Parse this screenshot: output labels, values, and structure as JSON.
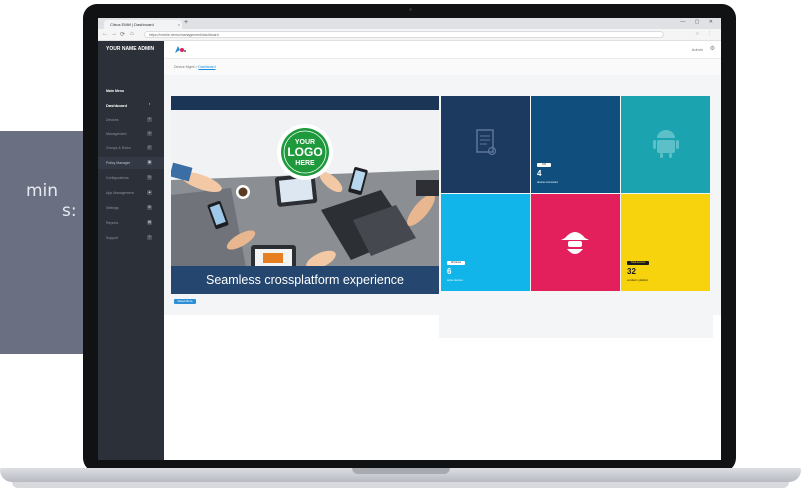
{
  "promo": {
    "line1": "min",
    "line2": "s:"
  },
  "browser": {
    "tab_title": "Citrus EMM | Dashboard",
    "tab_close": "×",
    "new_tab": "+",
    "window_controls": "— ▢ ✕",
    "back": "←",
    "forward": "→",
    "reload": "⟳",
    "home": "⌂",
    "url": "https://mobile-demo/management/dashboard",
    "ext_icons": "☆ ⋮"
  },
  "sidebar": {
    "brand": "YOUR NAME ADMIN",
    "section_label": "Main Menu",
    "items": [
      {
        "label": "Dashboard",
        "icon": "▪"
      },
      {
        "label": "Devices",
        "icon": "+"
      },
      {
        "label": "Management",
        "icon": "≡"
      },
      {
        "label": "Groups & Roles",
        "icon": "✓"
      },
      {
        "label": "Policy Manager",
        "icon": "▣"
      },
      {
        "label": "Configurations",
        "icon": "↻"
      },
      {
        "label": "App Management",
        "icon": "▲"
      },
      {
        "label": "Settings",
        "icon": "⚙"
      },
      {
        "label": "Reports",
        "icon": "▤"
      },
      {
        "label": "Support",
        "icon": "?"
      }
    ]
  },
  "appbar": {
    "admin_label": "Admin",
    "gear": "⚙"
  },
  "breadcrumb": {
    "home": "Device Mgmt >",
    "current": "Dashboard"
  },
  "banner": {
    "logo_line1": "YOUR",
    "logo_line2": "LOGO",
    "logo_line3": "HERE",
    "caption": "Seamless crossplatform experience",
    "button": "Read More"
  },
  "tiles": [
    {
      "color": "#1c3a5f",
      "icon": "document-icon"
    },
    {
      "color": "#104f7d",
      "badge": "iOS",
      "value": "4",
      "caption": "devices connected"
    },
    {
      "color": "#1ba3b0",
      "icon": "android-icon"
    },
    {
      "color": "#11b5ea",
      "badge": "Windows",
      "value": "6",
      "caption": "active devices"
    },
    {
      "color": "#e31f5c",
      "icon": "agent-icon"
    },
    {
      "color": "#f7d30e",
      "badge": "Total devices",
      "value": "32",
      "caption": "enrolled in platform"
    }
  ]
}
